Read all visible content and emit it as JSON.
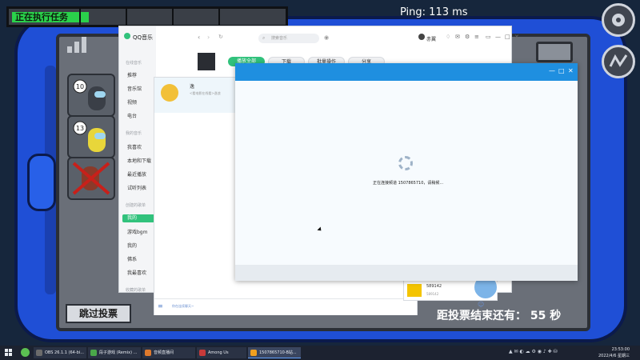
{
  "game": {
    "task_label": "正在执行任务",
    "ping": "Ping: 113 ms",
    "skip_vote": "跳过投票",
    "vote_timer": "距投票结束还有： 55 秒",
    "players": [
      {
        "level": "10",
        "color": "#3a3f47"
      },
      {
        "level": "13",
        "color": "#e8d63a"
      },
      {
        "level": "",
        "color": "#8a3a2a"
      }
    ]
  },
  "qq": {
    "title": "QQ音乐",
    "search_placeholder": "搜索音乐",
    "user": "赤翼",
    "sidebar": {
      "section_online": "在线音乐",
      "online_items": [
        "推荐",
        "音乐馆",
        "视频",
        "电台"
      ],
      "section_mine": "我的音乐",
      "mine_items": [
        "我喜欢",
        "本地和下载",
        "最近播放",
        "试听列表"
      ],
      "section_created": "创建的歌单",
      "created_items": [
        "我的",
        "游戏bgm",
        "我的",
        "佛系",
        "我最喜欢"
      ],
      "section_collected": "收藏的歌单"
    },
    "actions": {
      "play_all": "播放全部",
      "download": "下载",
      "batch": "批量操作",
      "share": "分享"
    }
  },
  "chat": {
    "contact_name": "逸",
    "contact_sub": "<看电影在线看>逸浪",
    "hint": "你在连续聊天~",
    "mini_card_id": "589142",
    "mini_card_sub": "589142"
  },
  "dialog": {
    "loading_text": "正在连接频道 1507865710，请稍候..."
  },
  "taskbar": {
    "items": [
      {
        "label": "OBS 26.1.1 (64-bi...",
        "color": "#6b6b6b"
      },
      {
        "label": "段子游戏 (Remix) ...",
        "color": "#4aa84a"
      },
      {
        "label": "音频直播间",
        "color": "#e07a2c"
      },
      {
        "label": "Among Us",
        "color": "#c83a3a"
      },
      {
        "label": "1507865710-B站...",
        "color": "#f0a020"
      }
    ],
    "time": "23:53:00",
    "date": "2022/4/6 星期三"
  }
}
